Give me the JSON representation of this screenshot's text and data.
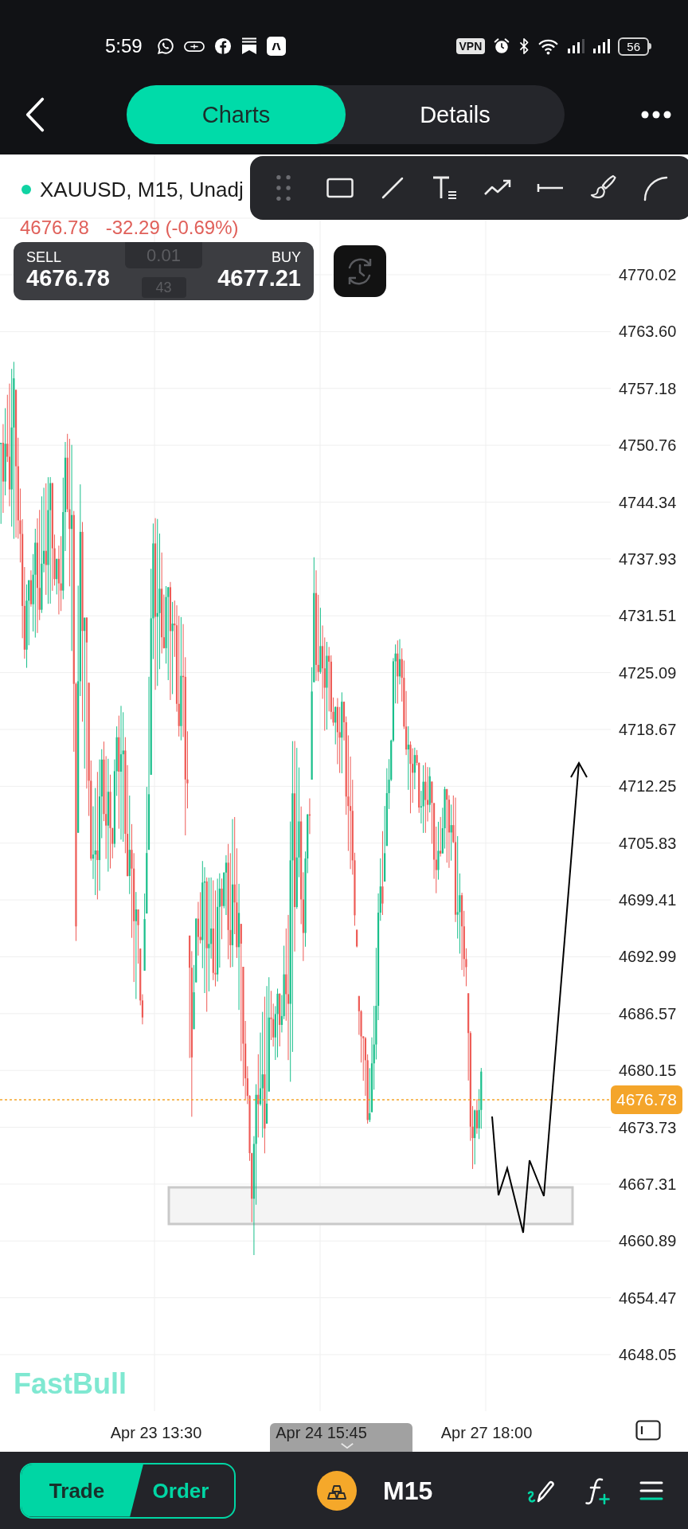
{
  "status_bar": {
    "time": "5:59",
    "vpn": "VPN",
    "battery": "56"
  },
  "nav": {
    "tabs": [
      {
        "label": "Charts",
        "selected": true
      },
      {
        "label": "Details",
        "selected": false
      }
    ]
  },
  "symbol": {
    "title": "XAUUSD, M15, Unadj"
  },
  "quote": {
    "last": "4676.78",
    "change": "-32.29 (-0.69%)"
  },
  "trade_panel": {
    "sell_label": "SELL",
    "sell_price": "4676.78",
    "lot": "0.01",
    "spread": "43",
    "buy_label": "BUY",
    "buy_price": "4677.21"
  },
  "chart": {
    "price_labels": [
      "4770.02",
      "4763.60",
      "4757.18",
      "4750.76",
      "4744.34",
      "4737.93",
      "4731.51",
      "4725.09",
      "4718.67",
      "4712.25",
      "4705.83",
      "4699.41",
      "4692.99",
      "4686.57",
      "4680.15",
      "4673.73",
      "4667.31",
      "4660.89",
      "4654.47",
      "4648.05"
    ],
    "current_price": "4676.78",
    "time_labels": [
      "Apr 23 13:30",
      "Apr 24 15:45",
      "Apr 27 18:00"
    ],
    "logo": "FastBull"
  },
  "bottom_bar": {
    "tabs": [
      {
        "label": "Trade",
        "selected": true
      },
      {
        "label": "Order",
        "selected": false
      }
    ],
    "timeframe": "M15"
  }
}
